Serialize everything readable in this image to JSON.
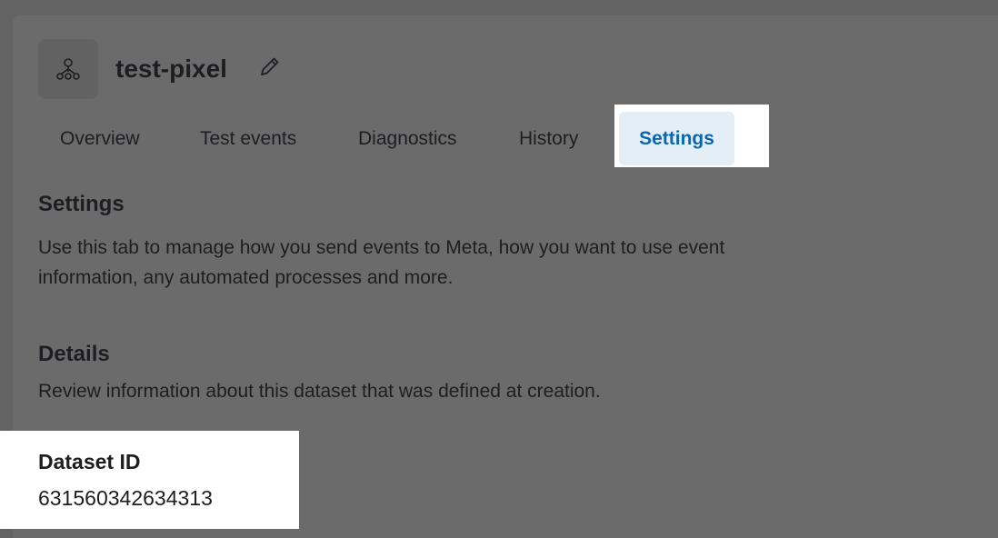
{
  "header": {
    "asset_icon": "pixel-network-icon",
    "title": "test-pixel",
    "edit_icon": "pencil-icon"
  },
  "tabs": [
    {
      "label": "Overview",
      "active": false
    },
    {
      "label": "Test events",
      "active": false
    },
    {
      "label": "Diagnostics",
      "active": false
    },
    {
      "label": "History",
      "active": false
    },
    {
      "label": "Settings",
      "active": true
    }
  ],
  "settings_section": {
    "heading": "Settings",
    "description_line1": "Use this tab to manage how you send events to Meta, how you want to use event",
    "description_line2": "information, any automated processes and more."
  },
  "details_section": {
    "heading": "Details",
    "description": "Review information about this dataset that was defined at creation."
  },
  "dataset": {
    "id_label": "Dataset ID",
    "id_value": "631560342634313"
  },
  "colors": {
    "active_tab_text": "#0a66b0",
    "active_tab_bg": "#e4eef7",
    "text_primary": "#1c1e21"
  }
}
